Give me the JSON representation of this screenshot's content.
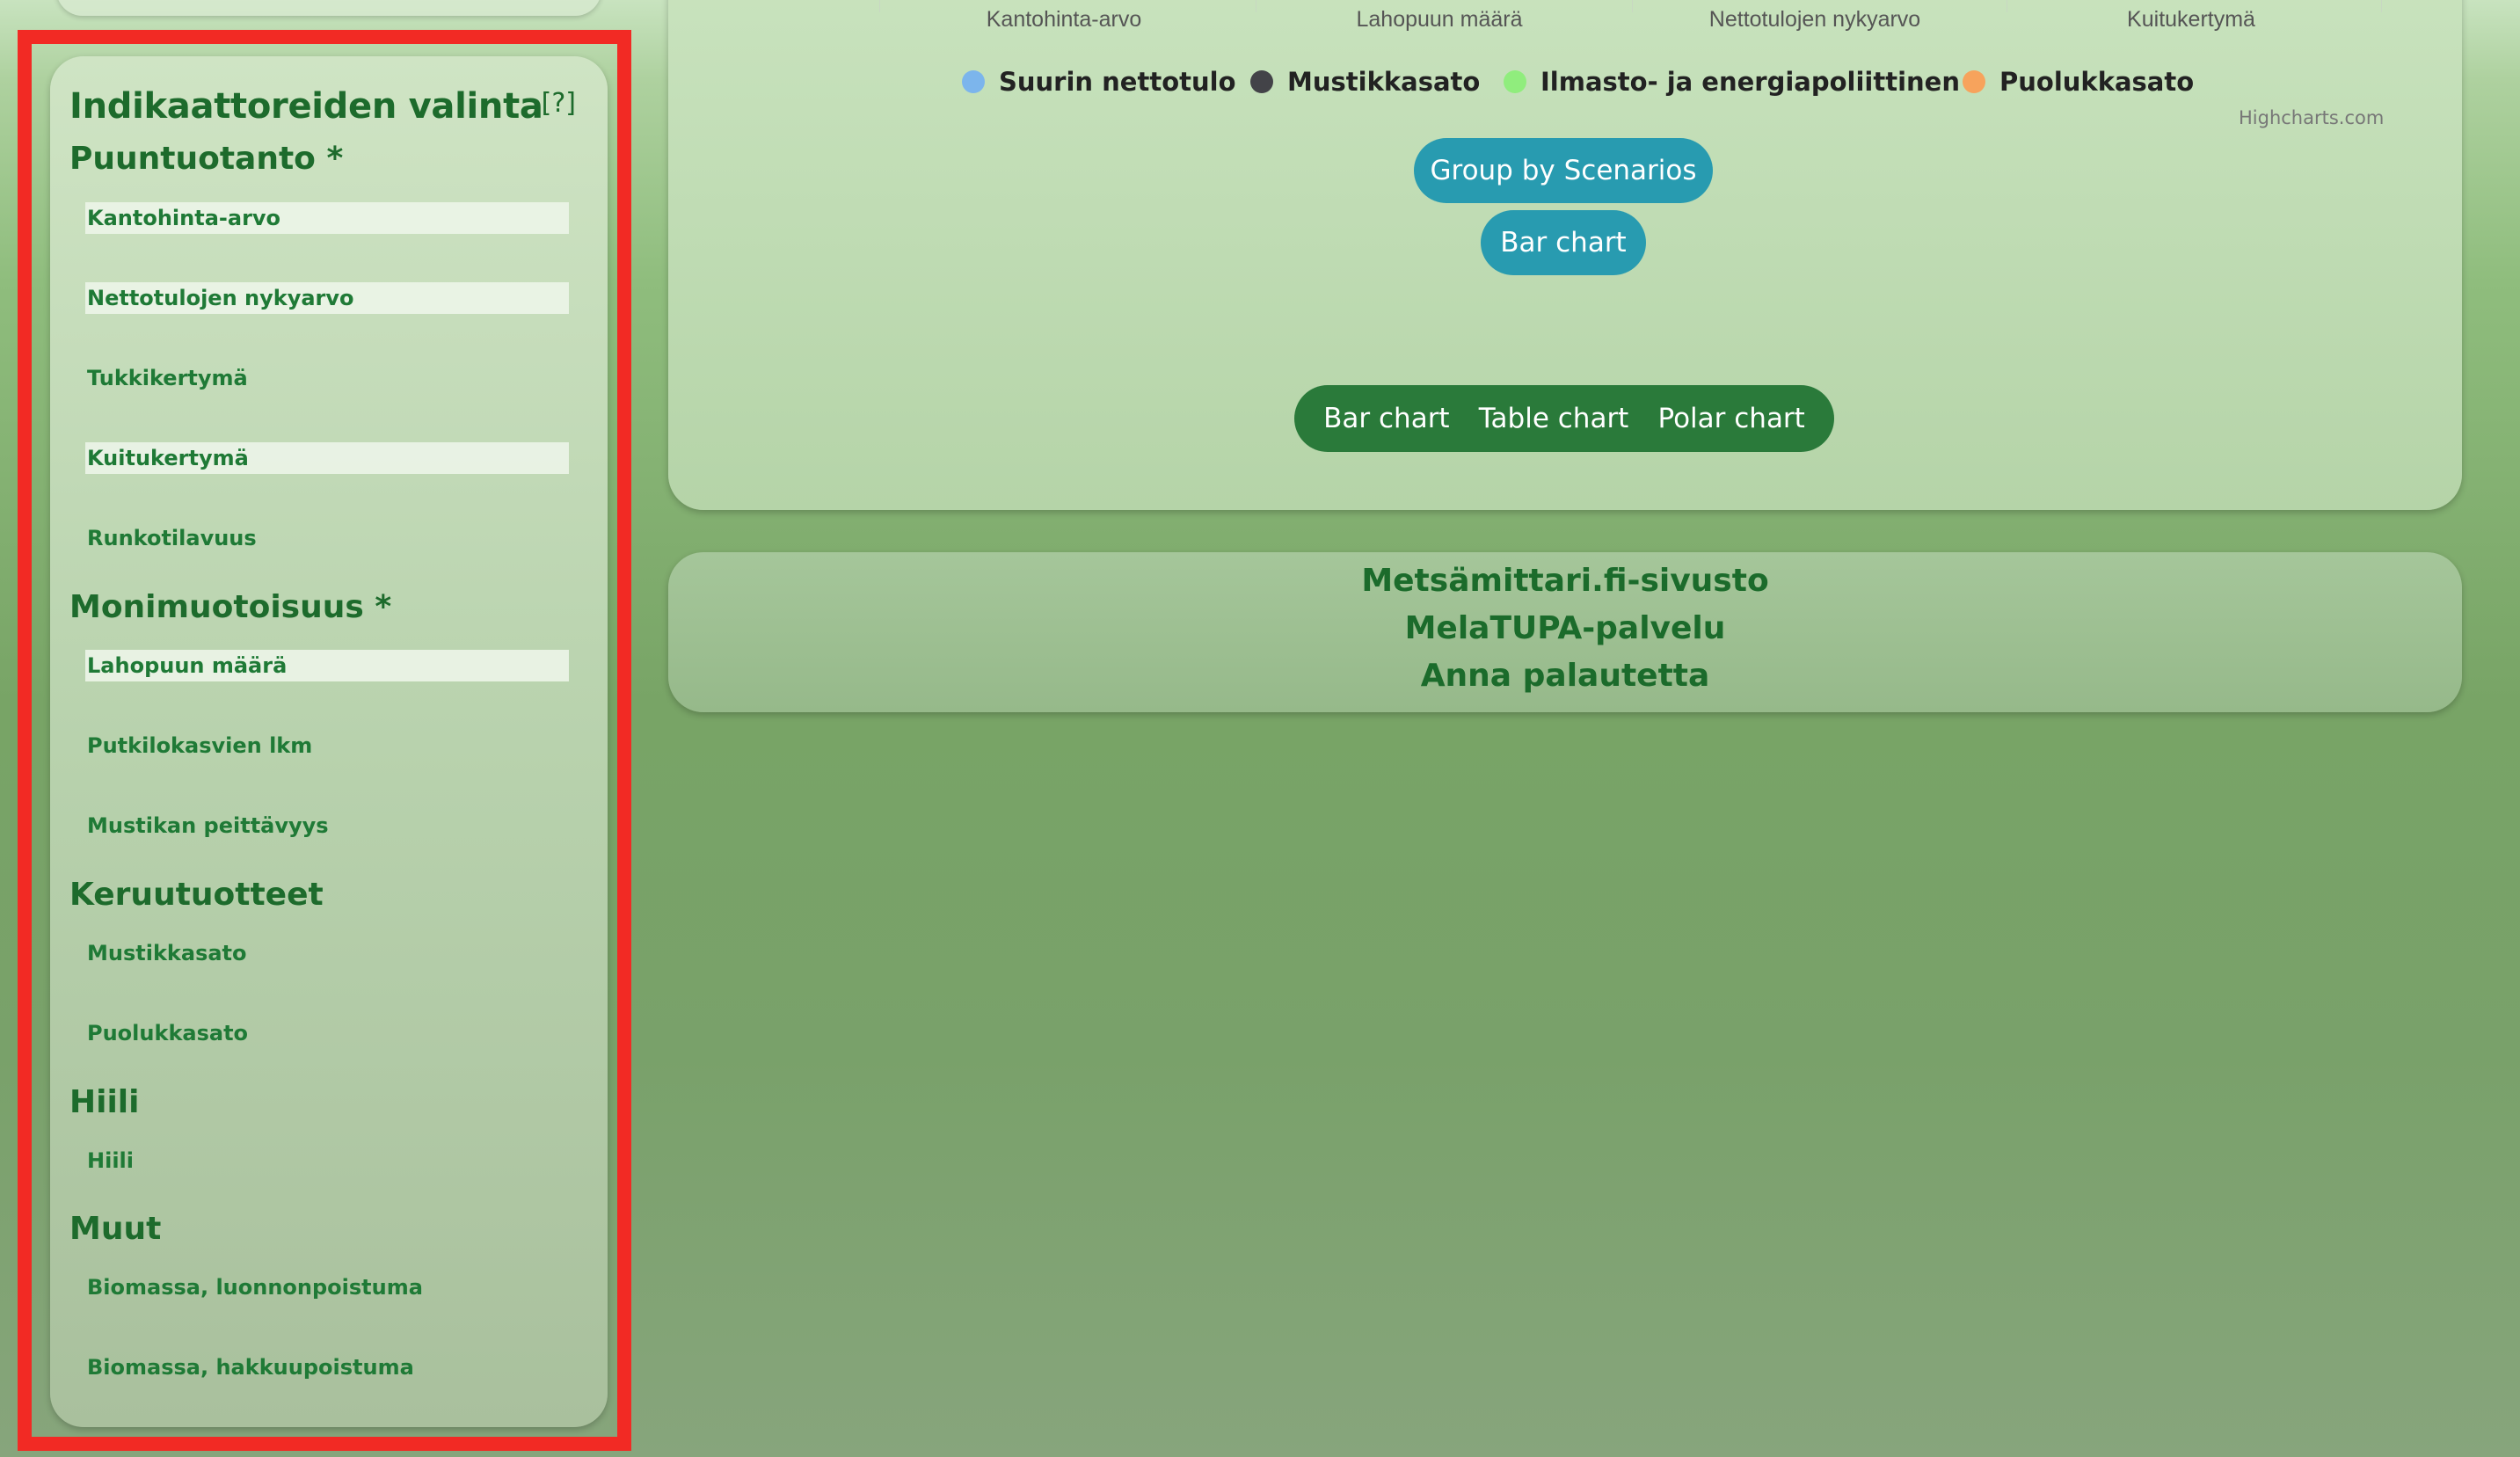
{
  "sidebar": {
    "title": "Indikaattoreiden valinta",
    "help": "[?]",
    "sections": [
      {
        "title": "Puuntuotanto *",
        "items": [
          {
            "label": "Kantohinta-arvo",
            "selected": true
          },
          {
            "label": "Nettotulojen nykyarvo",
            "selected": true
          },
          {
            "label": "Tukkikertymä",
            "selected": false
          },
          {
            "label": "Kuitukertymä",
            "selected": true
          },
          {
            "label": "Runkotilavuus",
            "selected": false
          }
        ]
      },
      {
        "title": "Monimuotoisuus *",
        "items": [
          {
            "label": "Lahopuun määrä",
            "selected": true
          },
          {
            "label": "Putkilokasvien lkm",
            "selected": false
          },
          {
            "label": "Mustikan peittävyys",
            "selected": false
          }
        ]
      },
      {
        "title": "Keruutuotteet",
        "items": [
          {
            "label": "Mustikkasato",
            "selected": false
          },
          {
            "label": "Puolukkasato",
            "selected": false
          }
        ]
      },
      {
        "title": "Hiili",
        "items": [
          {
            "label": "Hiili",
            "selected": false
          }
        ]
      },
      {
        "title": "Muut",
        "items": [
          {
            "label": "Biomassa, luonnonpoistuma",
            "selected": false
          },
          {
            "label": "Biomassa, hakkuupoistuma",
            "selected": false
          }
        ]
      }
    ]
  },
  "chart": {
    "categories": [
      "Kantohinta-arvo",
      "Lahopuun määrä",
      "Nettotulojen nykyarvo",
      "Kuitukertymä"
    ],
    "legend": [
      {
        "name": "Suurin nettotulo",
        "color": "#7cb5ec"
      },
      {
        "name": "Mustikkasato",
        "color": "#434348"
      },
      {
        "name": "Ilmasto- ja energiapoliittinen",
        "color": "#90ed7d"
      },
      {
        "name": "Puolukkasato",
        "color": "#f7a35c"
      }
    ],
    "credit": "Highcharts.com"
  },
  "buttons": {
    "group_by": "Group by Scenarios",
    "bar_chart": "Bar chart"
  },
  "chart_types": [
    "Bar chart",
    "Table chart",
    "Polar chart"
  ],
  "links": [
    "Metsämittari.fi-sivusto",
    "MelaTUPA-palvelu",
    "Anna palautetta"
  ]
}
